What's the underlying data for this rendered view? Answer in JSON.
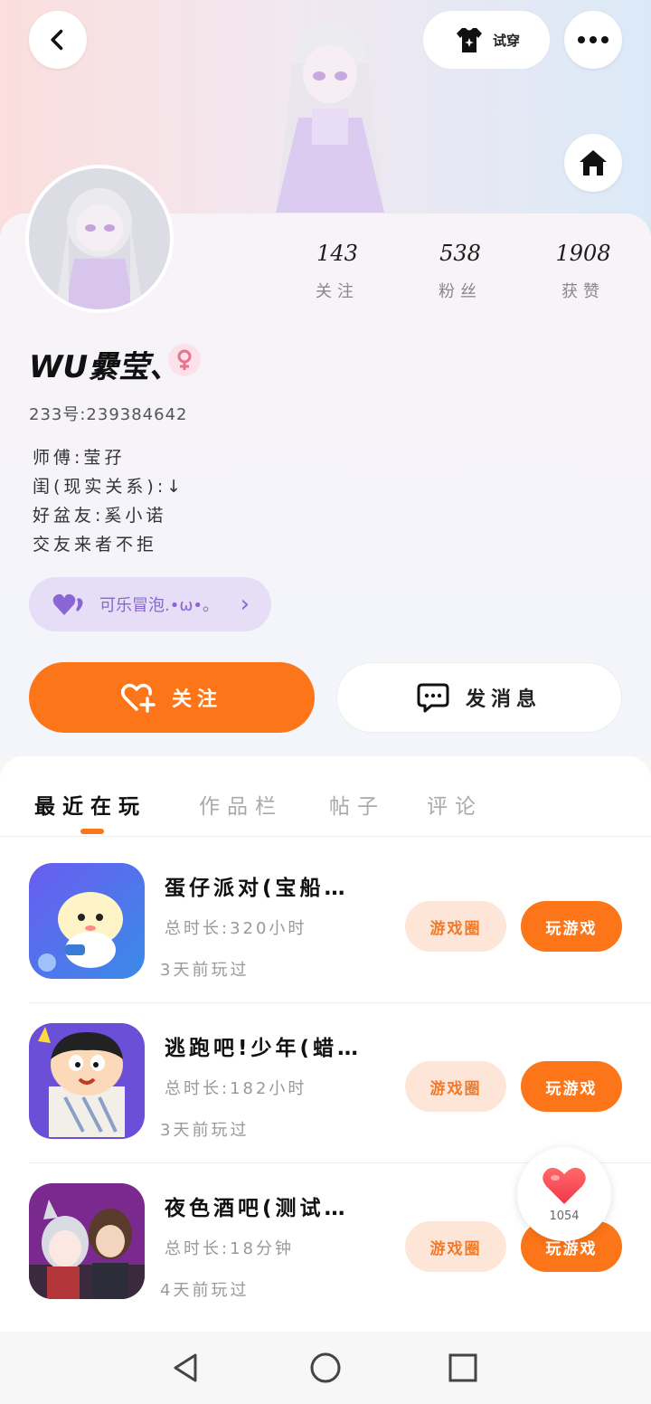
{
  "header": {
    "try_on_label": "试穿",
    "back_icon": "chevron-left-icon",
    "more_icon": "more-dots-icon",
    "home_icon": "home-icon"
  },
  "profile": {
    "stats": [
      {
        "value": "143",
        "label": "关注"
      },
      {
        "value": "538",
        "label": "粉丝"
      },
      {
        "value": "1908",
        "label": "获赞"
      }
    ],
    "name": "WU纍莹、",
    "gender_icon": "female-icon",
    "id_line": "233号:239384642",
    "bio_lines": [
      "师傅:莹孖",
      "闺(现实关系):↓",
      "好盆友:奚小诺",
      "交友来者不拒"
    ],
    "tag_label": "可乐冒泡.•ω•。",
    "follow_label": "关注",
    "message_label": "发消息"
  },
  "tabs": [
    "最近在玩",
    "作品栏",
    "帖子",
    "评论"
  ],
  "games": [
    {
      "title": "蛋仔派对(宝船…",
      "duration": "总时长:320小时",
      "last_played": "3天前玩过",
      "circle_label": "游戏圈",
      "play_label": "玩游戏"
    },
    {
      "title": "逃跑吧!少年(蜡…",
      "duration": "总时长:182小时",
      "last_played": "3天前玩过",
      "circle_label": "游戏圈",
      "play_label": "玩游戏"
    },
    {
      "title": "夜色酒吧(测试…",
      "duration": "总时长:18分钟",
      "last_played": "4天前玩过",
      "circle_label": "游戏圈",
      "play_label": "玩游戏"
    }
  ],
  "like_float": {
    "count": "1054"
  },
  "colors": {
    "accent": "#fc7518",
    "tag_bg": "#e6ddf6",
    "tag_text": "#8a65d4"
  }
}
